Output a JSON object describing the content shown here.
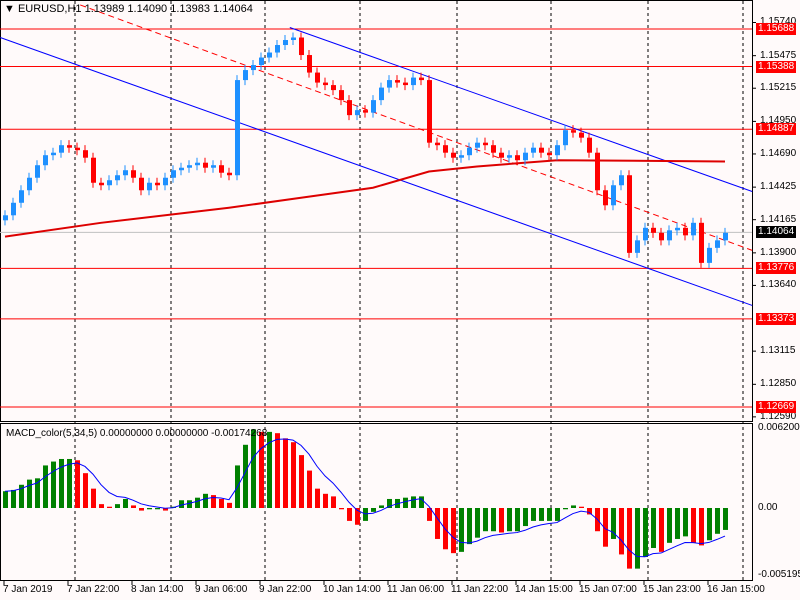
{
  "header": {
    "symbol": "EURUSD,H1",
    "ohlc": "1.13989 1.14090 1.13983 1.14064"
  },
  "macd_header": "MACD_color(5,34,5) 0.00000000 0.00000000 -0.00174268",
  "colors": {
    "bull": "#1e90ff",
    "bear": "#ff0000",
    "ma": "#dd0000",
    "channel": "#0000ff",
    "level": "#ff0000",
    "hist_up": "#008000",
    "hist_down": "#ff0000",
    "signal": "#0000ff"
  },
  "chart_data": [
    {
      "type": "candlestick",
      "title": "EURUSD,H1",
      "ylim": [
        1.1259,
        1.1574
      ],
      "price_ticks": [
        "1.15740",
        "1.15475",
        "1.15215",
        "1.14950",
        "1.14690",
        "1.14425",
        "1.14165",
        "1.13900",
        "1.13640",
        "1.13115",
        "1.12850",
        "1.12590"
      ],
      "price_tick_values": [
        1.1574,
        1.15475,
        1.15215,
        1.1495,
        1.1469,
        1.14425,
        1.14165,
        1.139,
        1.1364,
        1.13115,
        1.1285,
        1.1259
      ],
      "levels": [
        {
          "label": "1.15688",
          "value": 1.15688
        },
        {
          "label": "1.15388",
          "value": 1.15388
        },
        {
          "label": "1.14887",
          "value": 1.14887
        },
        {
          "label": "1.13776",
          "value": 1.13776
        },
        {
          "label": "1.13373",
          "value": 1.13373
        },
        {
          "label": "1.12669",
          "value": 1.12669
        }
      ],
      "bid": {
        "label": "1.14064",
        "value": 1.14064
      },
      "closes": [
        1.142,
        1.143,
        1.144,
        1.145,
        1.146,
        1.1468,
        1.147,
        1.1476,
        1.1474,
        1.1472,
        1.1466,
        1.1446,
        1.1444,
        1.1448,
        1.1452,
        1.1456,
        1.145,
        1.144,
        1.1446,
        1.1444,
        1.145,
        1.1456,
        1.1458,
        1.146,
        1.1462,
        1.1458,
        1.146,
        1.1454,
        1.1452,
        1.1528,
        1.1536,
        1.154,
        1.1546,
        1.155,
        1.1556,
        1.156,
        1.1562,
        1.1548,
        1.1534,
        1.1526,
        1.1524,
        1.152,
        1.1512,
        1.15,
        1.1504,
        1.1502,
        1.1512,
        1.1522,
        1.1528,
        1.1526,
        1.1524,
        1.153,
        1.1528,
        1.1478,
        1.1476,
        1.147,
        1.1466,
        1.1468,
        1.1474,
        1.1478,
        1.1476,
        1.147,
        1.1466,
        1.1468,
        1.1464,
        1.147,
        1.1474,
        1.147,
        1.1468,
        1.1476,
        1.1488,
        1.1486,
        1.1482,
        1.147,
        1.144,
        1.1428,
        1.1444,
        1.1452,
        1.139,
        1.14,
        1.141,
        1.1406,
        1.14,
        1.1408,
        1.141,
        1.1404,
        1.1414,
        1.1382,
        1.1394,
        1.14,
        1.1406
      ],
      "ma200": [
        [
          0,
          1.1403
        ],
        [
          12,
          1.1414
        ],
        [
          28,
          1.1426
        ],
        [
          37,
          1.1434
        ],
        [
          46,
          1.1442
        ],
        [
          53,
          1.1455
        ],
        [
          59,
          1.1459
        ],
        [
          69,
          1.1464
        ],
        [
          90,
          1.1463
        ]
      ],
      "channel": {
        "upper": [
          [
            35.6,
            1.157
          ],
          [
            93.4,
            1.1439
          ]
        ],
        "middle": [
          [
            9.4,
            1.1588
          ],
          [
            93.4,
            1.1392
          ]
        ],
        "lower": [
          [
            -0.6,
            1.1562
          ],
          [
            93.4,
            1.1348
          ]
        ]
      }
    },
    {
      "type": "bar",
      "title": "MACD_color(5,34,5)",
      "ylim": [
        -0.005195,
        0.0062009
      ],
      "ticks": [
        "0.0062009",
        "0.00",
        "-0.005195"
      ],
      "tick_values": [
        0.0062009,
        0,
        -0.005195
      ],
      "values": [
        0.0013,
        0.0014,
        0.0018,
        0.0022,
        0.0023,
        0.0033,
        0.0036,
        0.0038,
        0.0038,
        0.0037,
        0.0027,
        0.0015,
        0.0003,
        0.0001,
        0.0003,
        0.0007,
        0.0002,
        -0.0002,
        -0.0001,
        -0.0001,
        -0.0002,
        0.0001,
        0.0006,
        0.0006,
        0.0008,
        0.0011,
        0.001,
        0.0007,
        0.0004,
        0.0033,
        0.0049,
        0.0061,
        0.0059,
        0.0059,
        0.0058,
        0.0054,
        0.0051,
        0.0041,
        0.0029,
        0.0015,
        0.0011,
        0.0009,
        -0.0001,
        -0.001,
        -0.0013,
        -0.001,
        -0.0003,
        0.0002,
        0.0007,
        0.0007,
        0.0008,
        0.0009,
        0.0009,
        -0.001,
        -0.0024,
        -0.0032,
        -0.0035,
        -0.0034,
        -0.0028,
        -0.0023,
        -0.0018,
        -0.0018,
        -0.0019,
        -0.0018,
        -0.0018,
        -0.0014,
        -0.001,
        -0.001,
        -0.001,
        -0.001,
        -0.0001,
        0.0002,
        0.0001,
        -0.0005,
        -0.0018,
        -0.003,
        -0.0024,
        -0.0036,
        -0.0047,
        -0.0047,
        -0.0038,
        -0.0031,
        -0.0034,
        -0.0027,
        -0.0024,
        -0.0022,
        -0.0027,
        -0.0029,
        -0.0025,
        -0.002,
        -0.0017
      ]
    }
  ],
  "time_labels": [
    "7 Jan 2019",
    "7 Jan 22:00",
    "8 Jan 14:00",
    "9 Jan 06:00",
    "9 Jan 22:00",
    "10 Jan 14:00",
    "11 Jan 06:00",
    "11 Jan 22:00",
    "14 Jan 15:00",
    "15 Jan 07:00",
    "15 Jan 23:00",
    "16 Jan 15:00"
  ]
}
